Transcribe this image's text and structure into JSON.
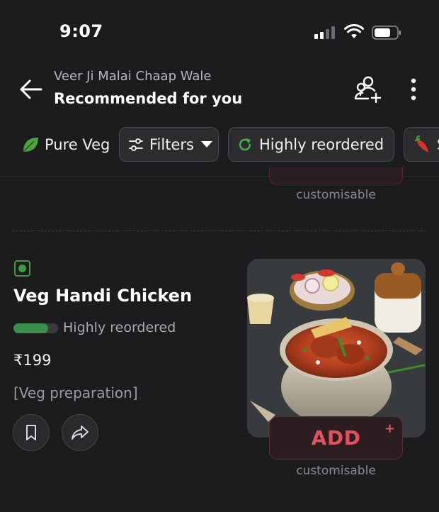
{
  "status_bar": {
    "time": "9:07"
  },
  "header": {
    "restaurant_name": "Veer Ji Malai Chaap Wale",
    "title": "Recommended for you"
  },
  "filters": {
    "pure_veg": "Pure Veg",
    "filters": "Filters",
    "highly_reordered": "Highly reordered",
    "spicy_partial": "S"
  },
  "previous_item": {
    "customisable": "customisable"
  },
  "item": {
    "name": "Veg Handi Chicken",
    "reorder_label": "Highly reordered",
    "reorder_level": 0.78,
    "price": "₹199",
    "description": "[Veg preparation]",
    "add_label": "ADD",
    "add_plus": "+",
    "customisable": "customisable"
  },
  "colors": {
    "background": "#1c1c1e",
    "veg_green": "#3f9a3f",
    "accent_red": "#e0525f",
    "reorder_green": "#3a8f4a"
  },
  "icons": {
    "back": "back-arrow-icon",
    "group": "group-order-icon",
    "more": "more-vertical-icon",
    "leaf": "leaf-icon",
    "sliders": "filter-sliders-icon",
    "reorder": "refresh-icon",
    "chili": "chili-icon",
    "bookmark": "bookmark-icon",
    "share": "share-icon"
  }
}
